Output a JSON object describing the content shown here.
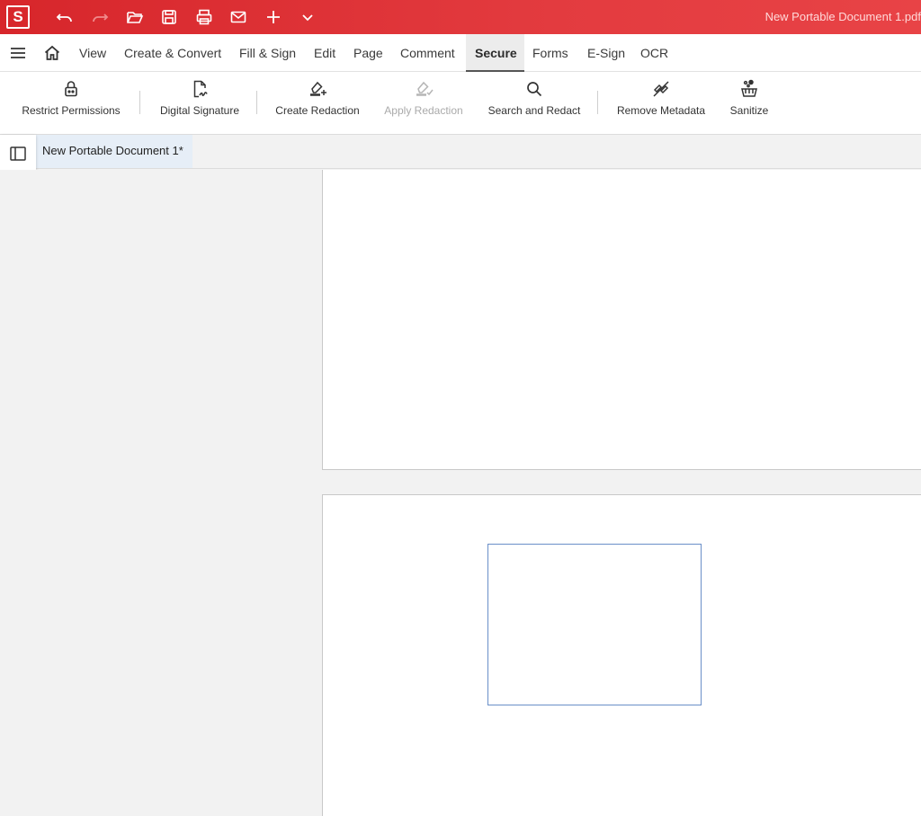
{
  "titlebar": {
    "app_logo": "S",
    "document_title": "New Portable Document 1.pdf",
    "quick_actions": [
      "undo-icon",
      "redo-icon",
      "open-folder-icon",
      "save-icon",
      "print-icon",
      "email-icon",
      "plus-icon",
      "chevron-down-icon"
    ]
  },
  "menubar": {
    "items": [
      {
        "label": "View"
      },
      {
        "label": "Create & Convert"
      },
      {
        "label": "Fill & Sign"
      },
      {
        "label": "Edit"
      },
      {
        "label": "Page"
      },
      {
        "label": "Comment"
      },
      {
        "label": "Secure",
        "active": true
      },
      {
        "label": "Forms"
      },
      {
        "label": "E-Sign"
      },
      {
        "label": "OCR"
      }
    ]
  },
  "ribbon": {
    "tools": [
      {
        "label": "Restrict Permissions",
        "icon": "lock-icon"
      },
      {
        "label": "Digital Signature",
        "icon": "signature-icon"
      },
      {
        "label": "Create Redaction",
        "icon": "create-redaction-icon"
      },
      {
        "label": "Apply Redaction",
        "icon": "apply-redaction-icon",
        "disabled": true
      },
      {
        "label": "Search and Redact",
        "icon": "search-icon"
      },
      {
        "label": "Remove Metadata",
        "icon": "remove-metadata-icon"
      },
      {
        "label": "Sanitize",
        "icon": "sanitize-icon"
      }
    ]
  },
  "tabs": {
    "document_tab": "New Portable Document 1*"
  },
  "colors": {
    "accent": "#d7262b",
    "annotation_border": "#6a8fc8"
  }
}
